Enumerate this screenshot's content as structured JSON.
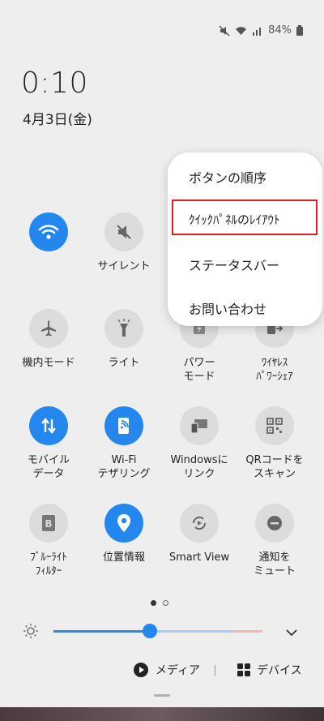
{
  "status_bar": {
    "battery": "84%"
  },
  "clock": {
    "time": "0:10",
    "date": "4月3日(金)"
  },
  "popup_menu": {
    "items": [
      "ボタンの順序",
      "ｸｲｯｸﾊﾟﾈﾙのﾚｲｱｳﾄ",
      "ステータスバー",
      "お問い合わせ"
    ]
  },
  "tiles": {
    "wifi": "",
    "silent": "サイレント",
    "airplane": "機内モード",
    "flashlight": "ライト",
    "power_mode": "パワー\nモード",
    "wireless_share": "ﾜｲﾔﾚｽ\nﾊﾟﾜｰｼｪｱ",
    "mobile_data": "モバイル\nデータ",
    "hotspot": "Wi-Fi\nテザリング",
    "link_windows": "Windowsに\nリンク",
    "qr_scan": "QRコードを\nスキャン",
    "blue_light": "ﾌﾞﾙｰﾗｲﾄ\nﾌｨﾙﾀｰ",
    "location": "位置情報",
    "smart_view": "Smart View",
    "mute_notif": "通知を\nミュート"
  },
  "brightness": {
    "level_percent": 46
  },
  "bottom_bar": {
    "media": "メディア",
    "devices": "デバイス"
  },
  "colors": {
    "accent": "#2487ee",
    "highlight": "#e02020",
    "panel": "#eeeeef"
  }
}
